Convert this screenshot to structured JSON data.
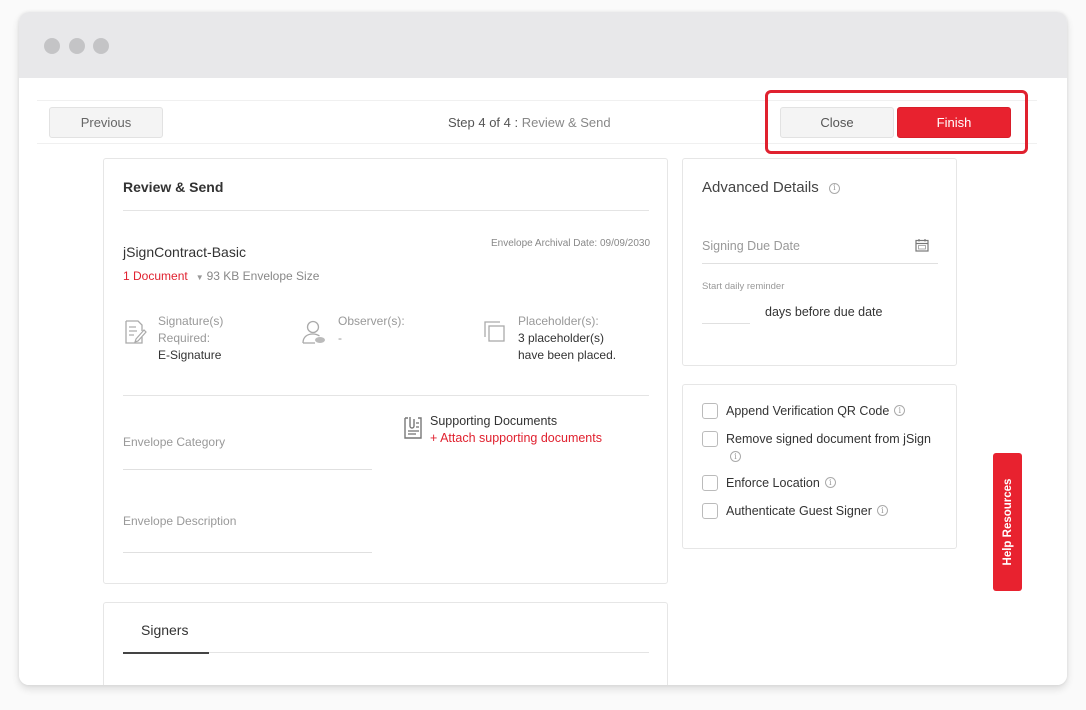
{
  "window": {
    "controls": [
      "close",
      "minimize",
      "maximize"
    ]
  },
  "stepbar": {
    "previous_label": "Previous",
    "step_prefix": "Step 4 of 4 :",
    "step_name": "Review & Send",
    "close_label": "Close",
    "finish_label": "Finish"
  },
  "review": {
    "title": "Review & Send",
    "envelope_name": "jSignContract-Basic",
    "archival_date": "Envelope Archival Date: 09/09/2030",
    "document_count": "1 Document",
    "envelope_size": "93 KB Envelope Size",
    "signatures": {
      "label1": "Signature(s)",
      "label2": "Required:",
      "value": "E-Signature",
      "icon": "signature-document-icon"
    },
    "observers": {
      "label": "Observer(s):",
      "value": "-",
      "icon": "user-icon"
    },
    "placeholders": {
      "label": "Placeholder(s):",
      "value1": "3 placeholder(s)",
      "value2": "have been placed.",
      "icon": "copy-icon"
    },
    "category_label": "Envelope Category",
    "description_label": "Envelope Description",
    "supporting_title": "Supporting Documents",
    "supporting_link": "+ Attach supporting documents"
  },
  "signers": {
    "tab_label": "Signers"
  },
  "advanced": {
    "title": "Advanced Details",
    "due_date_placeholder": "Signing Due Date",
    "reminder_label": "Start daily reminder",
    "reminder_value": "",
    "reminder_suffix": "days before due date"
  },
  "options": [
    {
      "label": "Append Verification QR Code",
      "checked": false
    },
    {
      "label": "Remove signed document from jSign",
      "checked": false
    },
    {
      "label": "Enforce Location",
      "checked": false
    },
    {
      "label": "Authenticate Guest Signer",
      "checked": false
    }
  ],
  "help": {
    "label": "Help Resources"
  },
  "colors": {
    "accent": "#e8222f",
    "highlight_border": "#e0212f",
    "titlebar": "#e8e8ea"
  }
}
